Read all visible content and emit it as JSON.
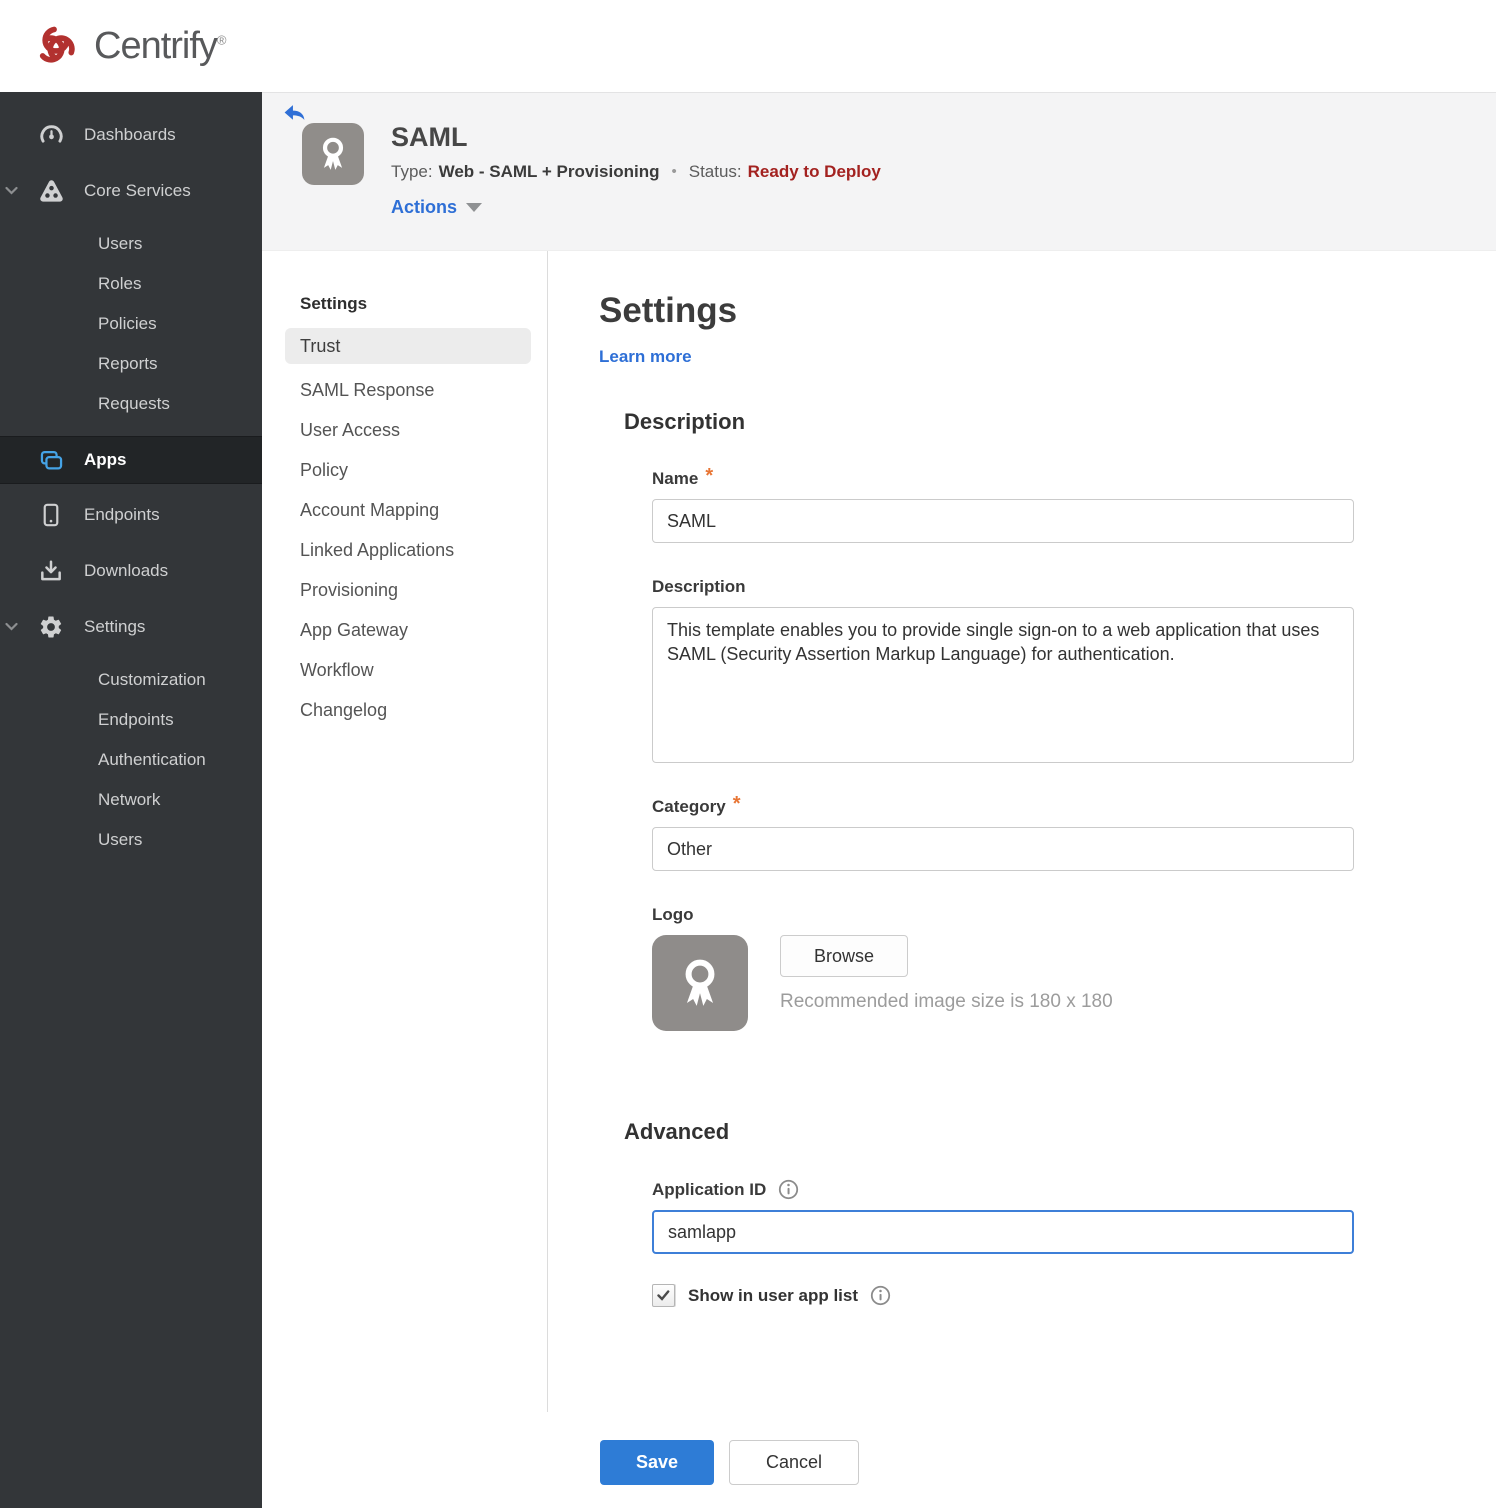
{
  "brand": {
    "name": "Centrify",
    "registered_mark": "®"
  },
  "colors": {
    "accent_blue": "#2e7cd6",
    "link_blue": "#2e6fd6",
    "status_red": "#a32220",
    "sidebar_bg": "#333639",
    "apps_icon_blue": "#45a3e6",
    "required_orange": "#e87534",
    "logo_red": "#b2312f"
  },
  "sidebar": {
    "items": {
      "dashboards": "Dashboards",
      "core_services": "Core Services",
      "users": "Users",
      "roles": "Roles",
      "policies": "Policies",
      "reports": "Reports",
      "requests": "Requests",
      "apps": "Apps",
      "endpoints": "Endpoints",
      "downloads": "Downloads",
      "settings": "Settings",
      "customization": "Customization",
      "endpoints_settings": "Endpoints",
      "authentication": "Authentication",
      "network": "Network",
      "users_settings": "Users"
    }
  },
  "header": {
    "title": "SAML",
    "type_label": "Type:",
    "type_value": "Web - SAML + Provisioning",
    "separator": "•",
    "status_label": "Status:",
    "status_value": "Ready to Deploy",
    "actions_label": "Actions"
  },
  "subnav": {
    "heading": "Settings",
    "active_item": "Trust",
    "items": [
      "SAML Response",
      "User Access",
      "Policy",
      "Account Mapping",
      "Linked Applications",
      "Provisioning",
      "App Gateway",
      "Workflow",
      "Changelog"
    ]
  },
  "form": {
    "title": "Settings",
    "learn_more": "Learn more",
    "required_marker": "*",
    "description_section": {
      "heading": "Description",
      "name_label": "Name",
      "name_value": "SAML",
      "description_label": "Description",
      "description_value": "This template enables you to provide single sign-on to a web application that uses SAML (Security Assertion Markup Language) for authentication.",
      "category_label": "Category",
      "category_value": "Other",
      "logo_label": "Logo",
      "browse_label": "Browse",
      "logo_hint": "Recommended image size is 180 x 180"
    },
    "advanced_section": {
      "heading": "Advanced",
      "application_id_label": "Application ID",
      "application_id_value": "samlapp",
      "show_in_user_app_list_label": "Show in user app list",
      "show_in_user_app_list_checked": true
    },
    "buttons": {
      "save": "Save",
      "cancel": "Cancel"
    }
  }
}
